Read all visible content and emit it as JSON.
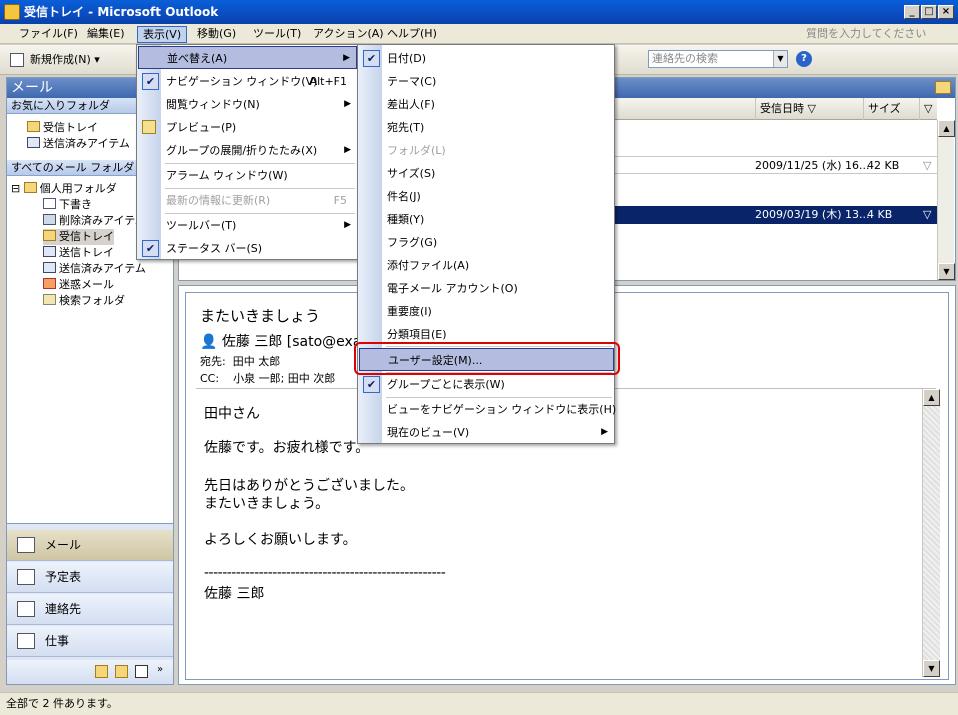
{
  "window": {
    "title": "受信トレイ - Microsoft Outlook"
  },
  "menubar": {
    "items": [
      "ファイル(F)",
      "編集(E)",
      "表示(V)",
      "移動(G)",
      "ツール(T)",
      "アクション(A)",
      "ヘルプ(H)"
    ],
    "help_placeholder": "質問を入力してください"
  },
  "toolbar": {
    "new_label": "新規作成(N)",
    "contact_search_placeholder": "連絡先の検索"
  },
  "nav": {
    "header": "メール",
    "favorites_title": "お気に入りフォルダ",
    "favorites": [
      "受信トレイ",
      "送信済みアイテム"
    ],
    "all_title": "すべてのメール フォルダ",
    "root": "個人用フォルダ",
    "folders": [
      "下書き",
      "削除済みアイテム",
      "受信トレイ",
      "送信トレイ",
      "送信済みアイテム",
      "迷惑メール",
      "検索フォルダ"
    ],
    "buttons": [
      "メール",
      "予定表",
      "連絡先",
      "仕事"
    ]
  },
  "list": {
    "columns": {
      "received": "受信日時",
      "size": "サイズ"
    },
    "rows": [
      {
        "date": "2009/11/25 (水) 16...",
        "size": "42 KB"
      },
      {
        "date": "2009/03/19 (木) 13...",
        "size": "4 KB"
      }
    ]
  },
  "reading": {
    "subject": "またいきましょう",
    "from": "佐藤 三郎 [sato@exa",
    "to_label": "宛先:",
    "to": "田中 太郎",
    "cc_label": "CC:",
    "cc": "小泉 一郎; 田中 次郎",
    "body": [
      "田中さん",
      "佐藤です。お疲れ様です。",
      "先日はありがとうございました。",
      "またいきましょう。",
      "よろしくお願いします。",
      "-----------------------------------------------------",
      "佐藤 三郎"
    ]
  },
  "status": {
    "text": "全部で 2 件あります。"
  },
  "view_menu": {
    "items": [
      {
        "label": "並べ替え(A)",
        "submenu": true,
        "highlight": true
      },
      {
        "label": "ナビゲーション ウィンドウ(V)",
        "shortcut": "Alt+F1",
        "checked": true
      },
      {
        "label": "閲覧ウィンドウ(N)",
        "submenu": true
      },
      {
        "label": "プレビュー(P)"
      },
      {
        "label": "グループの展開/折りたたみ(X)",
        "submenu": true
      },
      {
        "label": "アラーム ウィンドウ(W)"
      },
      {
        "label": "最新の情報に更新(R)",
        "shortcut": "F5",
        "disabled": true
      },
      {
        "label": "ツールバー(T)",
        "submenu": true
      },
      {
        "label": "ステータス バー(S)",
        "checked": true
      }
    ]
  },
  "arrange_menu": {
    "items": [
      {
        "label": "日付(D)",
        "checked": true
      },
      {
        "label": "テーマ(C)"
      },
      {
        "label": "差出人(F)"
      },
      {
        "label": "宛先(T)"
      },
      {
        "label": "フォルダ(L)",
        "disabled": true
      },
      {
        "label": "サイズ(S)"
      },
      {
        "label": "件名(J)"
      },
      {
        "label": "種類(Y)"
      },
      {
        "label": "フラグ(G)"
      },
      {
        "label": "添付ファイル(A)"
      },
      {
        "label": "電子メール アカウント(O)"
      },
      {
        "label": "重要度(I)"
      },
      {
        "label": "分類項目(E)"
      },
      {
        "label": "ユーザー設定(M)...",
        "highlight": true
      },
      {
        "label": "グループごとに表示(W)",
        "checked": true
      },
      {
        "label": "ビューをナビゲーション ウィンドウに表示(H)"
      },
      {
        "label": "現在のビュー(V)",
        "submenu": true
      }
    ]
  },
  "colors": {
    "highlight": "#b4bce0",
    "annotation": "#e00000"
  }
}
